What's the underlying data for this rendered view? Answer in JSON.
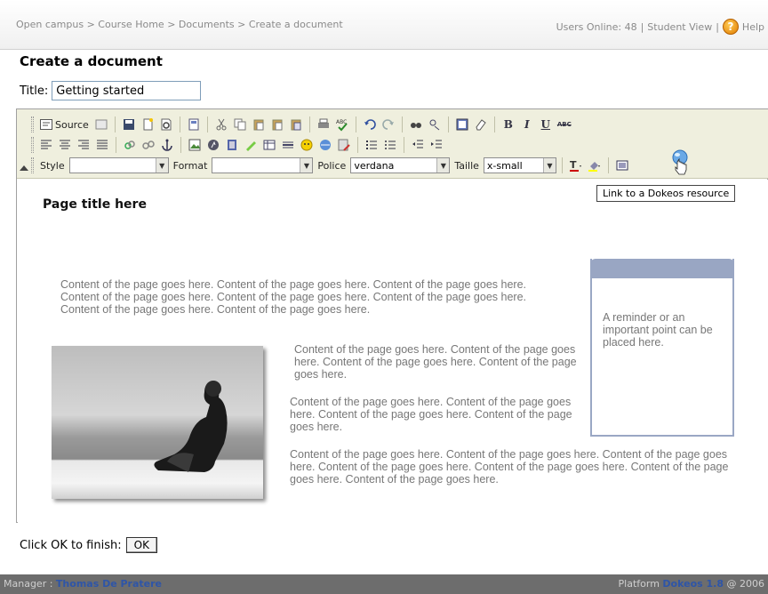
{
  "header": {
    "breadcrumb": [
      "Open campus",
      "Course Home",
      "Documents",
      "Create a document"
    ],
    "breadcrumb_sep": ">",
    "users_online": "Users Online: 48",
    "student_view": "Student View",
    "help": "Help"
  },
  "page": {
    "title": "Create a document",
    "title_label": "Title:",
    "title_value": "Getting started"
  },
  "toolbar": {
    "source_label": "Source",
    "style_label": "Style",
    "style_value": "",
    "format_label": "Format",
    "format_value": "",
    "font_label": "Police",
    "font_value": "verdana",
    "size_label": "Taille",
    "size_value": "x-small",
    "bold": "B",
    "italic": "I",
    "underline": "U",
    "strike": "ABC",
    "tooltip": "Link to a Dokeos resource"
  },
  "document": {
    "heading": "Page title here",
    "paragraph1": "Content of the page goes here. Content of the page goes here. Content of the page goes here. Content of the page goes here. Content of the page goes here. Content of the page goes here. Content of the page goes here. Content of the page goes here.",
    "paragraph2": "Content of the page goes here. Content of the page goes here. Content of the page goes here. Content of the page goes here.",
    "paragraph3": "Content of the page goes here. Content of the page goes here. Content of the page goes here. Content of the page goes here.",
    "paragraph4": "Content of the page goes here. Content of the page goes here. Content of the page goes here. Content of the page goes here. Content of the page goes here. Content of the page goes here. Content of the page goes here.",
    "sidebox_text": "A reminder or an important point can be placed here."
  },
  "finish": {
    "label": "Click OK to finish:",
    "ok": "OK"
  },
  "footer": {
    "manager_label": "Manager :",
    "manager_name": "Thomas De Pratere",
    "platform_label": "Platform",
    "platform_name": "Dokeos 1.8",
    "year": "@ 2006"
  }
}
